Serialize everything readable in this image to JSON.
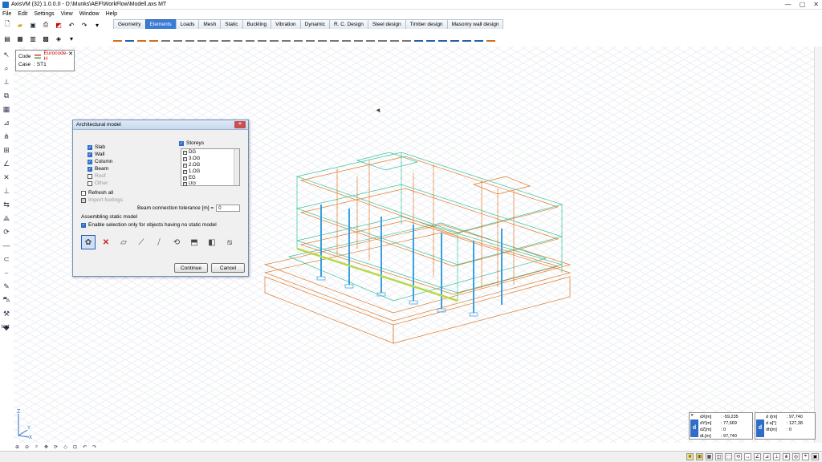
{
  "window": {
    "title": "AxisVM (32) 1.0.0.0 - D:\\Munks\\AEF\\WorkFlow\\Modell.axs MT"
  },
  "menu": [
    "File",
    "Edit",
    "Settings",
    "View",
    "Window",
    "Help"
  ],
  "tabs": [
    {
      "label": "Geometry",
      "active": false
    },
    {
      "label": "Elements",
      "active": true
    },
    {
      "label": "Loads",
      "active": false
    },
    {
      "label": "Mesh",
      "active": false
    },
    {
      "label": "Static",
      "active": false
    },
    {
      "label": "Buckling",
      "active": false
    },
    {
      "label": "Vibration",
      "active": false
    },
    {
      "label": "Dynamic",
      "active": false
    },
    {
      "label": "R. C. Design",
      "active": false
    },
    {
      "label": "Steel design",
      "active": false
    },
    {
      "label": "Timber design",
      "active": false
    },
    {
      "label": "Masonry wall design",
      "active": false
    }
  ],
  "info": {
    "code_label": "Code",
    "code_value": "Eurocode-H",
    "case_label": "Case",
    "case_value": ": ST1"
  },
  "left_toolbar_label": "text",
  "dialog": {
    "title": "Architectural model",
    "checkboxes": {
      "slab": "Slab",
      "wall": "Wall",
      "column": "Column",
      "beam": "Beam",
      "roof": "Roof",
      "other": "Other"
    },
    "storeys_label": "Storeys",
    "storeys": [
      "DG",
      "3.OG",
      "2.OG",
      "1.OG",
      "EG",
      "UG"
    ],
    "refresh_all": "Refresh all",
    "import_footings": "Import footings",
    "tolerance_label": "Beam connection tolerance [m] =",
    "tolerance_value": "0",
    "assembling_label": "Assembling static model",
    "enable_selection": "Enable selection only for objects having no static model",
    "continue_label": "Continue",
    "cancel_label": "Cancel"
  },
  "axes": {
    "z": "Z",
    "y": "Y",
    "x": "X"
  },
  "coords_left": [
    {
      "k": "dX[m]",
      "v": ": -59,235"
    },
    {
      "k": "dY[m]",
      "v": ": 77,669"
    },
    {
      "k": "dZ[m]",
      "v": ": 0"
    },
    {
      "k": "dL[m]",
      "v": ": 97,740"
    }
  ],
  "coords_right": [
    {
      "k": "d r[m]",
      "v": ": 97,740"
    },
    {
      "k": "d  a[°]",
      "v": ": 127,38"
    },
    {
      "k": "dh[m]",
      "v": ": 0"
    }
  ],
  "colors": {
    "accent": "#2e6ec7",
    "model_orange": "#e07a2a",
    "model_green": "#3cc29a",
    "model_blue": "#3a9fe0"
  }
}
